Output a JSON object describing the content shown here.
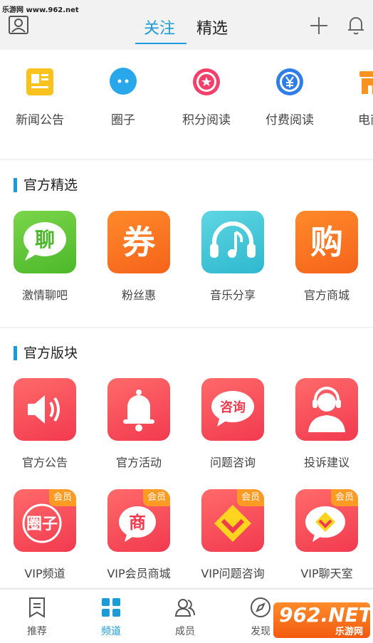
{
  "watermark": {
    "top": "乐游网 www.962.net",
    "bottom_main": "962.NET",
    "bottom_sub": "乐游网"
  },
  "header": {
    "tabs": [
      "关注",
      "精选"
    ]
  },
  "quick_links": [
    "新闻公告",
    "圈子",
    "积分阅读",
    "付费阅读",
    "电商"
  ],
  "official_picks": {
    "title": "官方精选",
    "items": [
      "激情聊吧",
      "粉丝惠",
      "音乐分享",
      "官方商城"
    ],
    "icon_glyphs": [
      "聊",
      "券",
      "",
      "购"
    ]
  },
  "official_sections": {
    "title": "官方版块",
    "items": [
      "官方公告",
      "官方活动",
      "问题咨询",
      "投诉建议"
    ],
    "bubble_text": "咨询",
    "vip_tag": "会员",
    "vip_items": [
      "VIP频道",
      "VIP会员商城",
      "VIP问题咨询",
      "VIP聊天室"
    ],
    "vip_glyphs": [
      "圈子",
      "商"
    ]
  },
  "bottom_nav": [
    "推荐",
    "频道",
    "成员",
    "发现"
  ],
  "colors": {
    "accent": "#1b9bd7",
    "vip_tag": "#ff9b23",
    "tile_red": "#f23a4f"
  }
}
